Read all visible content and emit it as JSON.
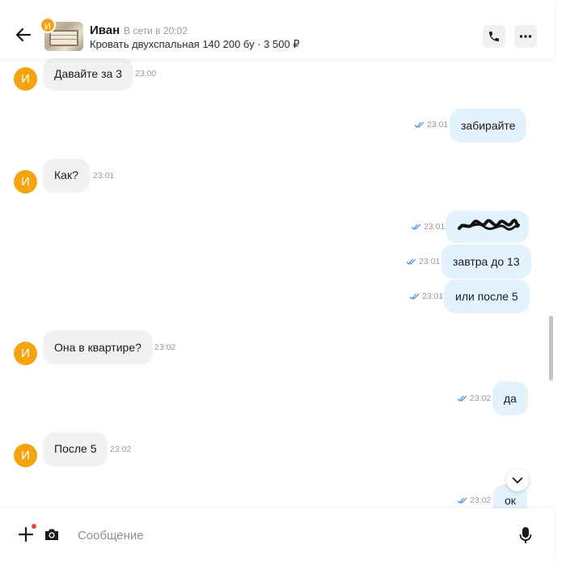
{
  "header": {
    "contact_name": "Иван",
    "status": "В сети в 20:02",
    "listing": "Кровать двухспальная 140 200 бу · 3 500 ₽",
    "avatar_initial": "И",
    "back_icon": "arrow-left-icon",
    "call_icon": "phone-icon",
    "more_icon": "more-dots-icon"
  },
  "messages": [
    {
      "dir": "in",
      "text": "Давайте за 3",
      "time": "23:00"
    },
    {
      "dir": "out",
      "text": "забирайте",
      "time": "23:01"
    },
    {
      "dir": "in",
      "text": "Как?",
      "time": "23:01"
    },
    {
      "dir": "out",
      "text": "",
      "redacted": true,
      "time": "23:01"
    },
    {
      "dir": "out",
      "text": "завтра до 13",
      "time": "23:01"
    },
    {
      "dir": "out",
      "text": "или после 5",
      "time": "23:01"
    },
    {
      "dir": "in",
      "text": "Она в квартире?",
      "time": "23:02"
    },
    {
      "dir": "out",
      "text": "да",
      "time": "23:02"
    },
    {
      "dir": "in",
      "text": "После 5",
      "time": "23:02"
    },
    {
      "dir": "out",
      "text": "ок",
      "time": "23:02"
    }
  ],
  "avatar_initial": "И",
  "composer": {
    "placeholder": "Сообщение",
    "value": "",
    "attach_icon": "plus-icon",
    "camera_icon": "camera-icon",
    "mic_icon": "microphone-icon"
  },
  "colors": {
    "avatar": "#f5a40f",
    "incoming_bubble": "#f1f1f1",
    "outgoing_bubble": "#e3f3fe",
    "read_ticks": "#3d8fe6",
    "notification_dot": "#f0423e"
  }
}
